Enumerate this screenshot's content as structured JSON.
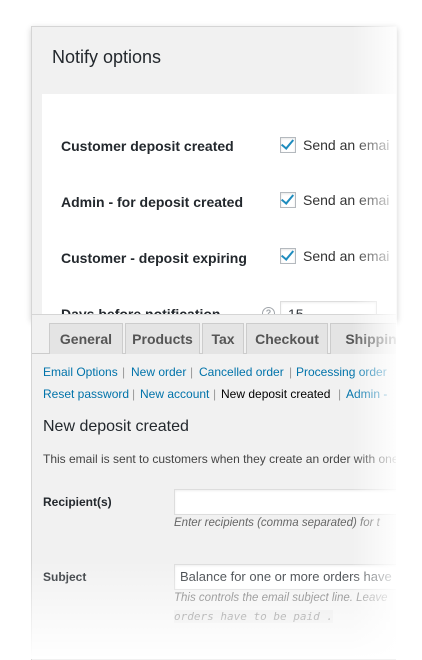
{
  "notify": {
    "title": "Notify options",
    "rows": [
      {
        "label": "Customer deposit created",
        "check_text": "Send an emai",
        "checked": true
      },
      {
        "label": "Admin - for deposit created",
        "check_text": "Send an emai",
        "checked": true
      },
      {
        "label": "Customer - deposit expiring",
        "check_text": "Send an emai",
        "checked": true
      }
    ],
    "days": {
      "label": "Days before notification",
      "help_icon": "?",
      "value": "15"
    }
  },
  "tabs": [
    "General",
    "Products",
    "Tax",
    "Checkout",
    "Shippin"
  ],
  "email_links": {
    "line1": [
      "Email Options",
      "New order",
      "Cancelled order",
      "Processing order"
    ],
    "line2_before": [
      "Reset password",
      "New account"
    ],
    "current": "New deposit created",
    "line2_after": [
      "Admin -"
    ],
    "separator": "|"
  },
  "section": {
    "heading": "New deposit created",
    "description": "This email is sent to customers when they create an order with one"
  },
  "fields": {
    "recipients": {
      "label": "Recipient(s)",
      "value": "",
      "help": "Enter recipients (comma separated) for t"
    },
    "subject": {
      "label": "Subject",
      "value": "Balance for one or more orders have",
      "help": "This controls the email subject line. Leave",
      "code": "orders have to be paid ."
    }
  },
  "colors": {
    "link": "#0073aa",
    "checkmark": "#1e8cbe",
    "panel_bg": "#f1f1f1"
  }
}
